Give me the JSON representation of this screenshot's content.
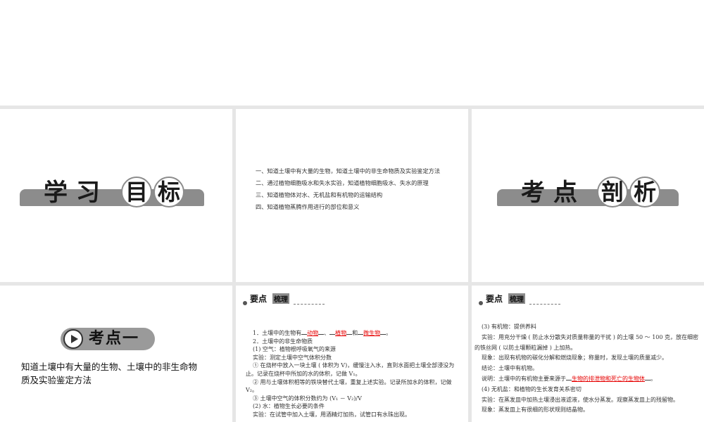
{
  "slide_xuexi": {
    "chars": [
      "学",
      "习",
      "目",
      "标"
    ]
  },
  "slide_objectives": {
    "items": [
      "一、知道土壤中有大量的生物，知道土壤中的非生命物质及实验鉴定方法",
      "二、通过植物细胞吸水和失水实验，知道植物细胞吸水、失水的原理",
      "三、知道植物体对水、无机盐和有机物的运输结构",
      "四、知道植物蒸腾作用进行的部位和意义"
    ]
  },
  "slide_kaodian": {
    "chars": [
      "考",
      "点",
      "剖",
      "析"
    ]
  },
  "slide_kaodian1": {
    "badge": "考点一",
    "desc": "知道土壤中有大量的生物、土壤中的非生命物质及实验鉴定方法"
  },
  "yaodian": {
    "title1": "要点",
    "title2": "梳理"
  },
  "slide_points1": {
    "l1_pre": "1．土壤中的生物有",
    "l1_a1": "动物",
    "l1_mid1": "、",
    "l1_a2": "植物",
    "l1_mid2": "和",
    "l1_a3": "微生物",
    "l1_end": "。",
    "l2": "2．土壤中的非生命物质",
    "l3": "(1) 空气：植物根呼吸氧气的来源",
    "l4": "实验：测定土壤中空气体积分数",
    "l5": "① 在烧杯中放入一块土壤 ( 体积为 V)，缓慢注入水，直到水面把土壤全部浸没为止。记录在烧杯中所加的水的体积，记做 V₁。",
    "l6": "② 用与土壤体积相等的铁块替代土壤，重复上述实验。记录所加水的体积，记做 V₂。",
    "l7": "③ 土壤中空气的体积分数约为 (V₁ － V₂)/V",
    "l8": "(2) 水：植物生长必要的条件",
    "l9": "实验：在试管中加入土壤，用酒精灯加热，试管口有水珠出现。"
  },
  "slide_points2": {
    "l1": "(3) 有机物：提供养料",
    "l2": "实验：用充分干燥 ( 防止水分散失对质量称量的干扰 ) 的土壤 50 ～ 100 克，放在细密的铁丝网 ( 以防土壤颗粒漏掉 ) 上加热。",
    "l3": "现象：出现有机物的碳化分解和燃烧现象；称量时，发现土壤的质量减少。",
    "l4": "结论：土壤中有机物。",
    "l5_pre": "说明：土壤中的有机物主要来源于",
    "l5_ans": "生物的排泄物和死亡的生物体",
    "l5_end": "。",
    "l6": "(4) 无机盐：和植物的生长发育关系密切",
    "l7": "实验：在蒸发皿中加热土壤浸出液滤液，使水分蒸发。观察蒸发皿上的残留物。",
    "l8": "现象：蒸发皿上有很细的形状规则结晶物。"
  }
}
